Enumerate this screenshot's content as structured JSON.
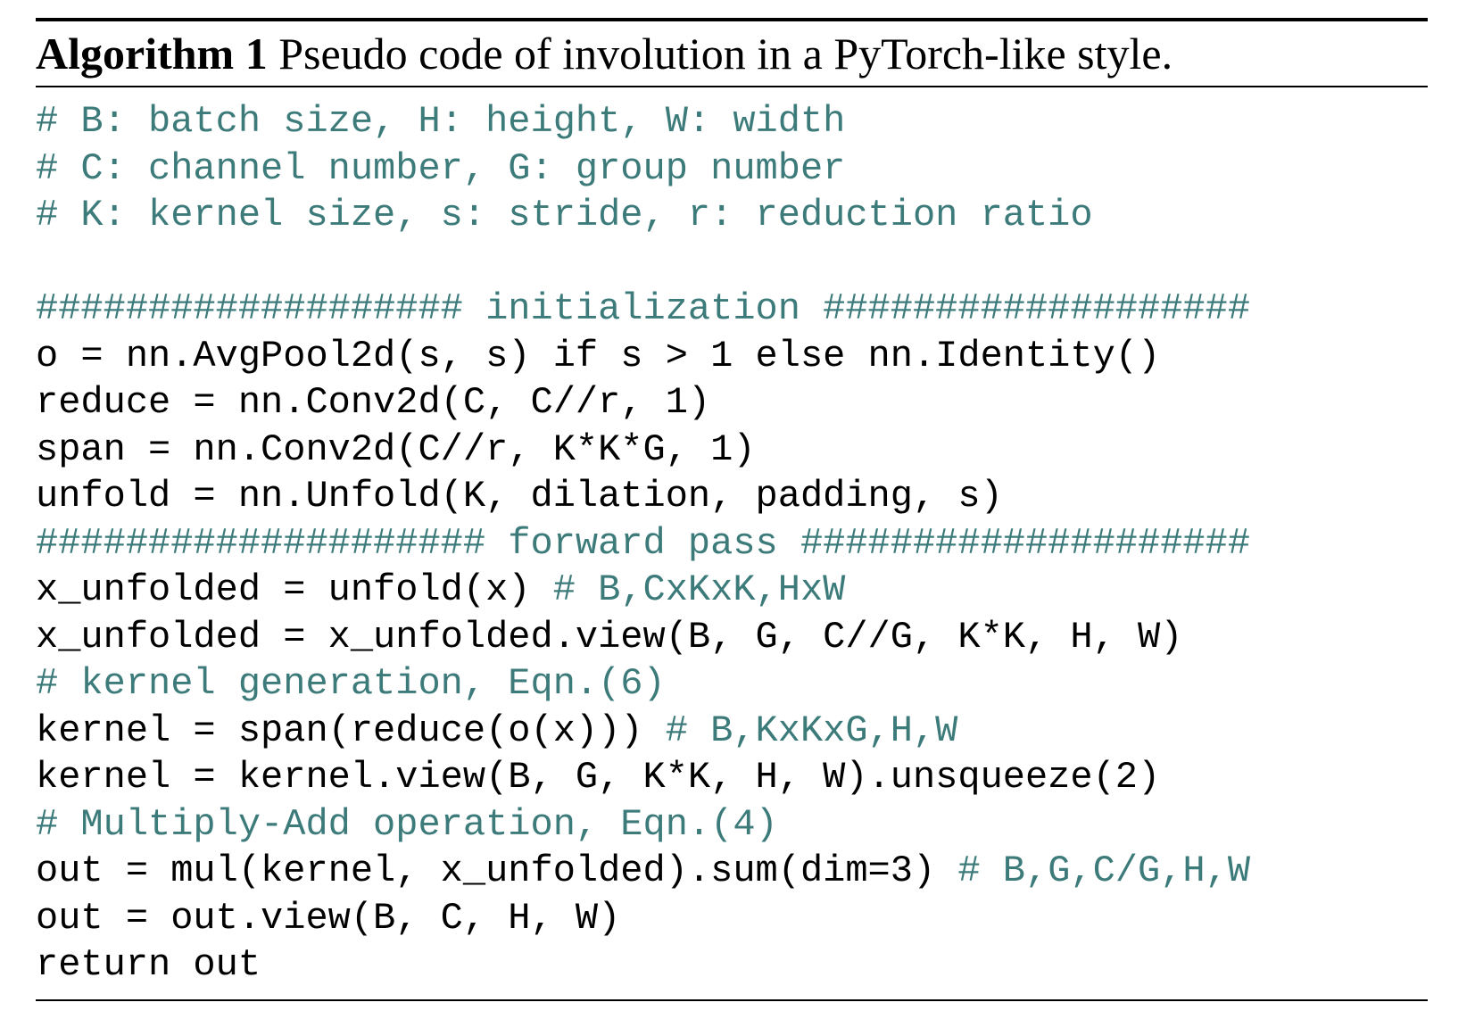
{
  "header": {
    "label": "Algorithm 1",
    "title": " Pseudo code of involution in a PyTorch-like style."
  },
  "code": {
    "l01": "# B: batch size, H: height, W: width",
    "l02": "# C: channel number, G: group number",
    "l03": "# K: kernel size, s: stride, r: reduction ratio",
    "l04": "",
    "l05": "################### initialization ###################",
    "l06": "o = nn.AvgPool2d(s, s) if s > 1 else nn.Identity()",
    "l07": "reduce = nn.Conv2d(C, C//r, 1)",
    "l08": "span = nn.Conv2d(C//r, K*K*G, 1)",
    "l09": "unfold = nn.Unfold(K, dilation, padding, s)",
    "l10": "#################### forward pass ####################",
    "l11a": "x_unfolded = unfold(x) ",
    "l11b": "# B,CxKxK,HxW",
    "l12": "x_unfolded = x_unfolded.view(B, G, C//G, K*K, H, W)",
    "l13": "# kernel generation, Eqn.(6)",
    "l14a": "kernel = span(reduce(o(x))) ",
    "l14b": "# B,KxKxG,H,W",
    "l15": "kernel = kernel.view(B, G, K*K, H, W).unsqueeze(2)",
    "l16": "# Multiply-Add operation, Eqn.(4)",
    "l17a": "out = mul(kernel, x_unfolded).sum(dim=3) ",
    "l17b": "# B,G,C/G,H,W",
    "l18": "out = out.view(B, C, H, W)",
    "l19": "return out"
  }
}
